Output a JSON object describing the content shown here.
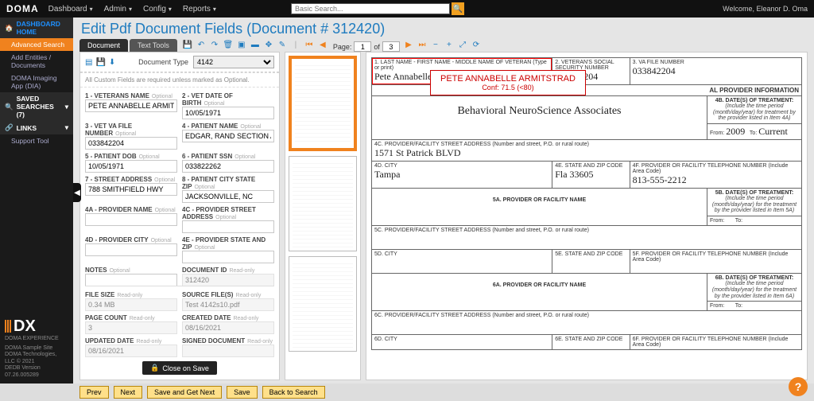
{
  "topnav": {
    "logo": "DOMA",
    "items": [
      "Dashboard",
      "Admin",
      "Config",
      "Reports"
    ],
    "search_placeholder": "Basic Search...",
    "welcome": "Welcome, Eleanor D. Oma"
  },
  "sidebar": {
    "home": "DASHBOARD HOME",
    "items": [
      "Advanced Search",
      "Add Entities / Documents",
      "DOMA Imaging App (DIA)"
    ],
    "saved": "SAVED SEARCHES (7)",
    "links": "LINKS",
    "support": "Support Tool",
    "brand_tag": "DOMA EXPERIENCE",
    "footer1": "DOMA Sample Site",
    "footer2": "DOMA Technologies, LLC © 2021",
    "footer3": "DEDB Version 07.26.005289"
  },
  "page_title": "Edit Pdf Document Fields (Document # 312420)",
  "tabs": {
    "doc": "Document",
    "text": "Text Tools"
  },
  "doc_type": {
    "label": "Document Type",
    "value": "4142"
  },
  "fields_note": "All Custom Fields are required unless marked as Optional.",
  "fields": {
    "vet_name": {
      "label": "1 - VETERANS NAME",
      "opt": "Optional",
      "value": "PETE ANNABELLE ARMITSTRAD"
    },
    "vet_dob": {
      "label": "2 - VET DATE OF BIRTH",
      "opt": "Optional",
      "value": "10/05/1971"
    },
    "vet_file": {
      "label": "3 - VET VA FILE NUMBER",
      "opt": "Optional",
      "value": "033842204"
    },
    "pat_name": {
      "label": "4 - PATIENT NAME",
      "opt": "Optional",
      "value": "EDGAR, RAND SECTION AZBREY III RAT"
    },
    "pat_dob": {
      "label": "5 - PATIENT DOB",
      "opt": "Optional",
      "value": "10/05/1971"
    },
    "pat_ssn": {
      "label": "6 - PATIENT SSN",
      "opt": "Optional",
      "value": "033822262"
    },
    "street": {
      "label": "7 - STREET ADDRESS",
      "opt": "Optional",
      "value": "788 SMITHFIELD HWY"
    },
    "csz": {
      "label": "8 - PATIENT CITY STATE ZIP",
      "opt": "Optional",
      "value": "JACKSONVILLE, NC"
    },
    "prov_name": {
      "label": "4A - PROVIDER NAME",
      "opt": "Optional",
      "value": ""
    },
    "prov_street": {
      "label": "4C - PROVIDER STREET ADDRESS",
      "opt": "Optional",
      "value": ""
    },
    "prov_city": {
      "label": "4D - PROVIDER CITY",
      "opt": "Optional",
      "value": ""
    },
    "prov_state": {
      "label": "4E - PROVIDER STATE AND ZIP",
      "opt": "Optional",
      "value": ""
    },
    "notes": {
      "label": "NOTES",
      "opt": "Optional",
      "value": ""
    },
    "doc_id": {
      "label": "DOCUMENT ID",
      "opt": "Read-only",
      "value": "312420"
    },
    "file_size": {
      "label": "FILE SIZE",
      "opt": "Read-only",
      "value": "0.34 MB"
    },
    "source": {
      "label": "SOURCE FILE(S)",
      "opt": "Read-only",
      "value": "Test 4142s10.pdf"
    },
    "page_count": {
      "label": "PAGE COUNT",
      "opt": "Read-only",
      "value": "3"
    },
    "created": {
      "label": "CREATED DATE",
      "opt": "Read-only",
      "value": "08/16/2021"
    },
    "updated": {
      "label": "UPDATED DATE",
      "opt": "Read-only",
      "value": "08/16/2021"
    },
    "signed": {
      "label": "SIGNED DOCUMENT",
      "opt": "Read-only",
      "value": ""
    }
  },
  "close_on_save": "Close on Save",
  "pager": {
    "label": "Page:",
    "cur": "1",
    "of_label": "of",
    "total": "3"
  },
  "ocr": {
    "text": "PETE ANNABELLE ARMITSTRAD",
    "conf": "Conf: 71.5 (<80)"
  },
  "form": {
    "c1": "1. LAST NAME - FIRST NAME - MIDDLE NAME OF VETERAN (Type or print)",
    "v1": "Pete  Annabelle  Armitstrad",
    "c2": "2. VETERAN'S SOCIAL SECURITY NUMBER",
    "v2": "033842204",
    "c3": "3. VA FILE NUMBER",
    "v3": "033842204",
    "hdrA": "AL PROVIDER INFORMATION",
    "c4a": "4A. PROVIDER OR FACILITY NAME",
    "v4a": "Behavioral NeuroScience Associates",
    "c4b": "4B. DATE(S) OF TREATMENT:",
    "note4b": "(Include the time period (month/day/year) for treatment by the provider listed in Item 4A)",
    "from": "From:",
    "to": "To:",
    "v4b_from": "2009",
    "v4b_to": "Current",
    "c4c": "4C. PROVIDER/FACILITY STREET ADDRESS (Number and street, P.O. or rural route)",
    "v4c": "1571  St  Patrick  BLVD",
    "c4d": "4D. CITY",
    "v4d": "Tampa",
    "c4e": "4E. STATE AND ZIP CODE",
    "v4e": "Fla   33605",
    "c4f": "4F. PROVIDER OR FACILITY TELEPHONE NUMBER (Include Area Code)",
    "v4f": "813-555-2212",
    "c5a": "5A. PROVIDER OR FACILITY NAME",
    "c5b": "5B. DATE(S) OF TREATMENT:",
    "note5b": "(Include the time period (month/day/year) for the treatment by the provider listed in Item 5A)",
    "c5c": "5C. PROVIDER/FACILITY STREET ADDRESS (Number and street, P.O. or rural route)",
    "c5d": "5D. CITY",
    "c5e": "5E. STATE AND ZIP CODE",
    "c5f": "5F. PROVIDER OR FACILITY TELEPHONE NUMBER (Include Area Code)",
    "c6a": "6A. PROVIDER OR FACILITY NAME",
    "c6b": "6B. DATE(S) OF TREATMENT:",
    "note6b": "(Include the time period (month/day/year) for the treatment by the provider listed in Item 6A)",
    "c6c": "6C. PROVIDER/FACILITY STREET ADDRESS (Number and street, P.O. or rural route)",
    "c6d": "6D. CITY",
    "c6e": "6E. STATE AND ZIP CODE",
    "c6f": "6F. PROVIDER OR FACILITY TELEPHONE NUMBER (Include Area Code)"
  },
  "buttons": {
    "prev": "Prev",
    "next": "Next",
    "sgn": "Save and Get Next",
    "save": "Save",
    "back": "Back to Search"
  }
}
